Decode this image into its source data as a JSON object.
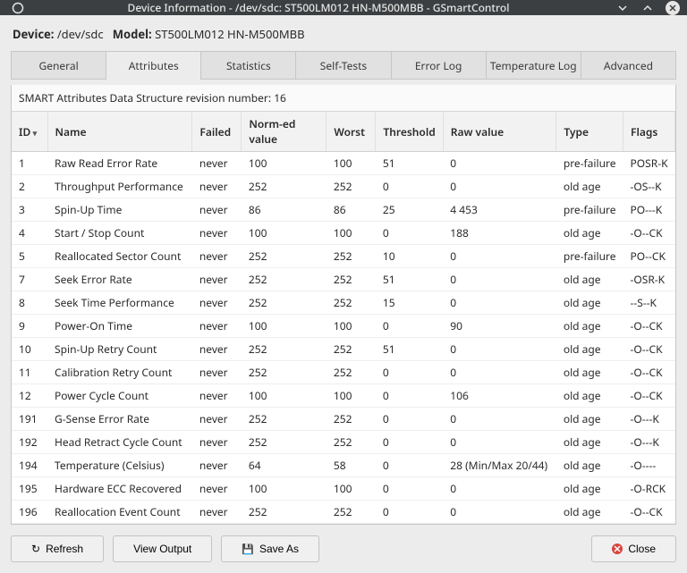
{
  "window": {
    "title": "Device Information - /dev/sdc: ST500LM012 HN-M500MBB - GSmartControl"
  },
  "device": {
    "label_device": "Device:",
    "device_path": "/dev/sdc",
    "label_model": "Model:",
    "model": "ST500LM012 HN-M500MBB"
  },
  "tabs": [
    "General",
    "Attributes",
    "Statistics",
    "Self-Tests",
    "Error Log",
    "Temperature Log",
    "Advanced"
  ],
  "active_tab": 1,
  "revision_text": "SMART Attributes Data Structure revision number: 16",
  "columns": [
    "ID",
    "Name",
    "Failed",
    "Norm-ed value",
    "Worst",
    "Threshold",
    "Raw value",
    "Type",
    "Flags"
  ],
  "rows": [
    {
      "id": "1",
      "name": "Raw Read Error Rate",
      "failed": "never",
      "norm": "100",
      "worst": "100",
      "thr": "51",
      "raw": "0",
      "type": "pre-failure",
      "flags": "POSR-K"
    },
    {
      "id": "2",
      "name": "Throughput Performance",
      "failed": "never",
      "norm": "252",
      "worst": "252",
      "thr": "0",
      "raw": "0",
      "type": "old age",
      "flags": "-OS--K"
    },
    {
      "id": "3",
      "name": "Spin-Up Time",
      "failed": "never",
      "norm": "86",
      "worst": "86",
      "thr": "25",
      "raw": "4 453",
      "type": "pre-failure",
      "flags": "PO---K"
    },
    {
      "id": "4",
      "name": "Start / Stop Count",
      "failed": "never",
      "norm": "100",
      "worst": "100",
      "thr": "0",
      "raw": "188",
      "type": "old age",
      "flags": "-O--CK"
    },
    {
      "id": "5",
      "name": "Reallocated Sector Count",
      "failed": "never",
      "norm": "252",
      "worst": "252",
      "thr": "10",
      "raw": "0",
      "type": "pre-failure",
      "flags": "PO--CK"
    },
    {
      "id": "7",
      "name": "Seek Error Rate",
      "failed": "never",
      "norm": "252",
      "worst": "252",
      "thr": "51",
      "raw": "0",
      "type": "old age",
      "flags": "-OSR-K"
    },
    {
      "id": "8",
      "name": "Seek Time Performance",
      "failed": "never",
      "norm": "252",
      "worst": "252",
      "thr": "15",
      "raw": "0",
      "type": "old age",
      "flags": "--S--K"
    },
    {
      "id": "9",
      "name": "Power-On Time",
      "failed": "never",
      "norm": "100",
      "worst": "100",
      "thr": "0",
      "raw": "90",
      "type": "old age",
      "flags": "-O--CK"
    },
    {
      "id": "10",
      "name": "Spin-Up Retry Count",
      "failed": "never",
      "norm": "252",
      "worst": "252",
      "thr": "51",
      "raw": "0",
      "type": "old age",
      "flags": "-O--CK"
    },
    {
      "id": "11",
      "name": "Calibration Retry Count",
      "failed": "never",
      "norm": "252",
      "worst": "252",
      "thr": "0",
      "raw": "0",
      "type": "old age",
      "flags": "-O--CK"
    },
    {
      "id": "12",
      "name": "Power Cycle Count",
      "failed": "never",
      "norm": "100",
      "worst": "100",
      "thr": "0",
      "raw": "106",
      "type": "old age",
      "flags": "-O--CK"
    },
    {
      "id": "191",
      "name": "G-Sense Error Rate",
      "failed": "never",
      "norm": "252",
      "worst": "252",
      "thr": "0",
      "raw": "0",
      "type": "old age",
      "flags": "-O---K"
    },
    {
      "id": "192",
      "name": "Head Retract Cycle Count",
      "failed": "never",
      "norm": "252",
      "worst": "252",
      "thr": "0",
      "raw": "0",
      "type": "old age",
      "flags": "-O---K"
    },
    {
      "id": "194",
      "name": "Temperature (Celsius)",
      "failed": "never",
      "norm": "64",
      "worst": "58",
      "thr": "0",
      "raw": "28 (Min/Max 20/44)",
      "type": "old age",
      "flags": "-O----"
    },
    {
      "id": "195",
      "name": "Hardware ECC Recovered",
      "failed": "never",
      "norm": "100",
      "worst": "100",
      "thr": "0",
      "raw": "0",
      "type": "old age",
      "flags": "-O-RCK"
    },
    {
      "id": "196",
      "name": "Reallocation Event Count",
      "failed": "never",
      "norm": "252",
      "worst": "252",
      "thr": "0",
      "raw": "0",
      "type": "old age",
      "flags": "-O--CK"
    }
  ],
  "buttons": {
    "refresh": "Refresh",
    "view_output": "View Output",
    "save_as": "Save As",
    "close": "Close"
  }
}
